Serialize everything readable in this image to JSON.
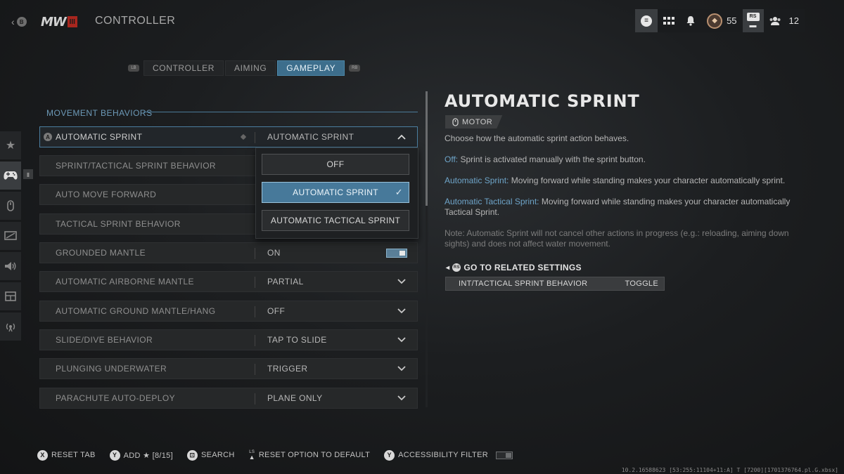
{
  "header": {
    "back_button": "B",
    "logo_text": "MW",
    "logo_badge": "III",
    "title": "CONTROLLER",
    "top_right": {
      "rank_value": "55",
      "rs_label": "RS",
      "party_count": "12"
    }
  },
  "tabs": {
    "left_bumper": "LB",
    "right_bumper": "RB",
    "items": [
      {
        "label": "CONTROLLER"
      },
      {
        "label": "AIMING"
      },
      {
        "label": "GAMEPLAY"
      }
    ],
    "active_index": 2
  },
  "section": {
    "title": "MOVEMENT BEHAVIORS"
  },
  "settings": [
    {
      "label": "AUTOMATIC SPRINT",
      "value": "AUTOMATIC SPRINT",
      "button_hint": "A"
    },
    {
      "label": "SPRINT/TACTICAL SPRINT BEHAVIOR",
      "value": ""
    },
    {
      "label": "AUTO MOVE FORWARD",
      "value": ""
    },
    {
      "label": "TACTICAL SPRINT BEHAVIOR",
      "value": ""
    },
    {
      "label": "GROUNDED MANTLE",
      "value": "ON"
    },
    {
      "label": "AUTOMATIC AIRBORNE MANTLE",
      "value": "PARTIAL"
    },
    {
      "label": "AUTOMATIC GROUND MANTLE/HANG",
      "value": "OFF"
    },
    {
      "label": "SLIDE/DIVE BEHAVIOR",
      "value": "TAP TO SLIDE"
    },
    {
      "label": "PLUNGING UNDERWATER",
      "value": "TRIGGER"
    },
    {
      "label": "PARACHUTE AUTO-DEPLOY",
      "value": "PLANE ONLY"
    }
  ],
  "dropdown": {
    "options": [
      {
        "label": "OFF"
      },
      {
        "label": "AUTOMATIC SPRINT"
      },
      {
        "label": "AUTOMATIC TACTICAL SPRINT"
      }
    ],
    "selected_index": 1
  },
  "description": {
    "title": "AUTOMATIC SPRINT",
    "tag": "MOTOR",
    "intro": "Choose how the automatic sprint action behaves.",
    "items": [
      {
        "term": "Off:",
        "text": " Sprint is activated manually with the sprint button."
      },
      {
        "term": "Automatic Sprint:",
        "text": " Moving forward while standing makes your character automatically sprint."
      },
      {
        "term": "Automatic Tactical Sprint:",
        "text": " Moving forward while standing makes your character automatically Tactical Sprint."
      }
    ],
    "note": "Note: Automatic Sprint will not cancel other actions in progress (e.g.: reloading, aiming down sights) and does not affect water movement.",
    "related_title": "GO TO RELATED SETTINGS",
    "related_button_hint": "RS",
    "related_setting": {
      "label": "INT/TACTICAL SPRINT BEHAVIOR",
      "value": "TOGGLE"
    }
  },
  "footer": {
    "items": [
      {
        "button": "X",
        "label": "RESET TAB"
      },
      {
        "button": "Y",
        "label": "ADD ★ [8/15]"
      },
      {
        "button": "⊡",
        "label": "SEARCH"
      },
      {
        "button": "LS",
        "label": "RESET OPTION TO DEFAULT"
      },
      {
        "button": "Y",
        "label": "ACCESSIBILITY FILTER"
      }
    ]
  },
  "build_string": "10.2.16588623 [53:255:11104+11:A] T [7200][1701376764.pl.G.xbsx]",
  "colors": {
    "accent": "#3d6e8c",
    "highlight_text": "#6ea4c8",
    "selected_option": "#47799a",
    "logo_red": "#a8261e"
  },
  "icons": {
    "rail": [
      "star-icon",
      "gamepad-icon",
      "mouse-icon",
      "display-icon",
      "speaker-icon",
      "interface-icon",
      "network-icon"
    ]
  }
}
